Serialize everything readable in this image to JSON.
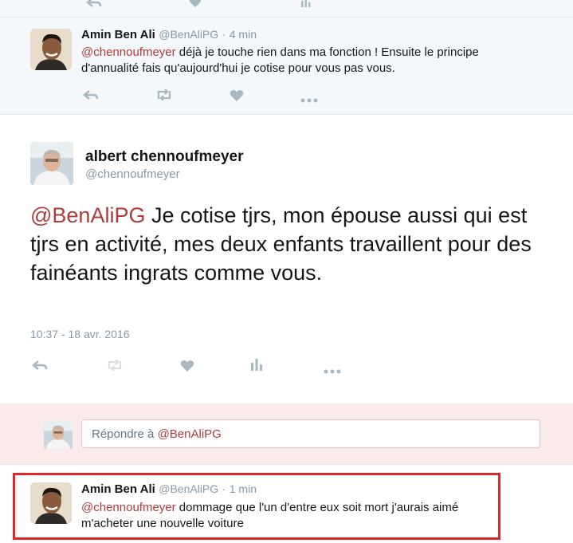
{
  "tweet_top": {
    "name": "Amin Ben Ali",
    "handle": "@BenAliPG",
    "separator": "·",
    "time": "4 min",
    "mention": "@chennoufmeyer",
    "text_after_mention": " déjà je touche rien dans ma fonction ! Ensuite le principe",
    "text_line2": "d'annualité fais qu'aujourd'hui je cotise pour vous pas vous."
  },
  "main_tweet": {
    "name": "albert chennoufmeyer",
    "handle": "@chennoufmeyer",
    "mention": "@BenAliPG",
    "text": " Je cotise tjrs, mon épouse aussi qui est tjrs en activité, mes deux enfants travaillent pour des fainéants ingrats comme vous.",
    "timestamp": "10:37 - 18 avr. 2016"
  },
  "reply_box": {
    "prefix": "Répondre à ",
    "mention": "@BenAliPG"
  },
  "tweet_bottom": {
    "name": "Amin Ben Ali",
    "handle": "@BenAliPG",
    "separator": "·",
    "time": "1 min",
    "mention": "@chennoufmeyer",
    "text_after_mention": " dommage que l'un d'entre eux soit mort j'aurais aimé",
    "text_line2": "m'acheter une nouvelle voiture"
  },
  "icons": [
    "reply-icon",
    "retweet-icon",
    "like-icon",
    "analytics-icon",
    "more-icon"
  ],
  "colors": {
    "mention": "#b03b3b",
    "highlight_border": "#e0262b",
    "reply_bar_bg": "#fbeaea",
    "muted_text": "#8899a6"
  }
}
